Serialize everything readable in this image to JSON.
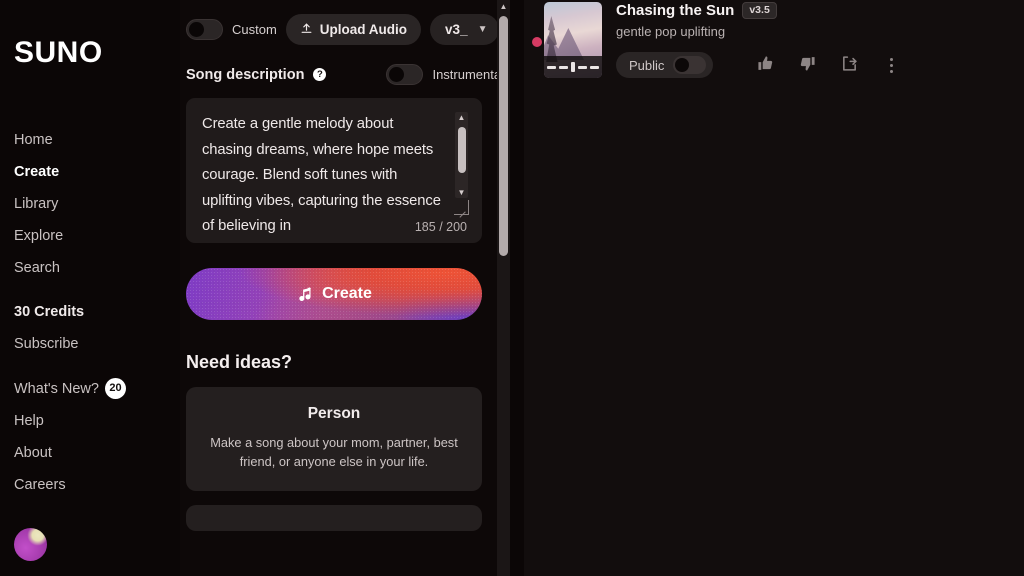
{
  "brand": {
    "logo": "SUNO"
  },
  "sidebar": {
    "nav": [
      {
        "label": "Home",
        "active": false
      },
      {
        "label": "Create",
        "active": true
      },
      {
        "label": "Library",
        "active": false
      },
      {
        "label": "Explore",
        "active": false
      },
      {
        "label": "Search",
        "active": false
      }
    ],
    "account": [
      {
        "label": "30 Credits"
      },
      {
        "label": "Subscribe"
      }
    ],
    "whats_new": {
      "label": "What's New?",
      "badge": "20"
    },
    "footer": [
      {
        "label": "Help"
      },
      {
        "label": "About"
      },
      {
        "label": "Careers"
      }
    ]
  },
  "composer": {
    "custom_toggle": {
      "label": "Custom",
      "on": false
    },
    "upload_button": {
      "label": "Upload Audio",
      "icon": "upload-icon"
    },
    "version_select": {
      "value": "v3_",
      "icon": "chevron-down-icon"
    },
    "description_label": "Song description",
    "help_icon": "?",
    "instrumental_toggle": {
      "label": "Instrumental",
      "on": false
    },
    "textarea": {
      "value": "Create a gentle melody about chasing dreams, where hope meets courage. Blend soft tunes with uplifting vibes, capturing the essence of believing in",
      "counter": "185 / 200"
    },
    "create_button": {
      "label": "Create",
      "icon": "music-note-icon"
    },
    "ideas_heading": "Need ideas?",
    "idea_cards": [
      {
        "title": "Person",
        "description": "Make a song about your mom, partner, best friend, or anyone else in your life."
      }
    ]
  },
  "song": {
    "title": "Chasing the Sun",
    "version": "v3.5",
    "tags": "gentle pop uplifting",
    "visibility": {
      "label": "Public",
      "on": false
    },
    "actions": [
      {
        "name": "thumbs-up",
        "label": "Like"
      },
      {
        "name": "thumbs-down",
        "label": "Dislike"
      },
      {
        "name": "share",
        "label": "Share"
      },
      {
        "name": "more",
        "label": "More options"
      }
    ]
  },
  "colors": {
    "background": "#0b0707",
    "panel": "#0d0808",
    "card": "#241f1f",
    "accent_purple": "#7f3cc6",
    "accent_red": "#e4553f",
    "status_dot": "#d63b63"
  }
}
